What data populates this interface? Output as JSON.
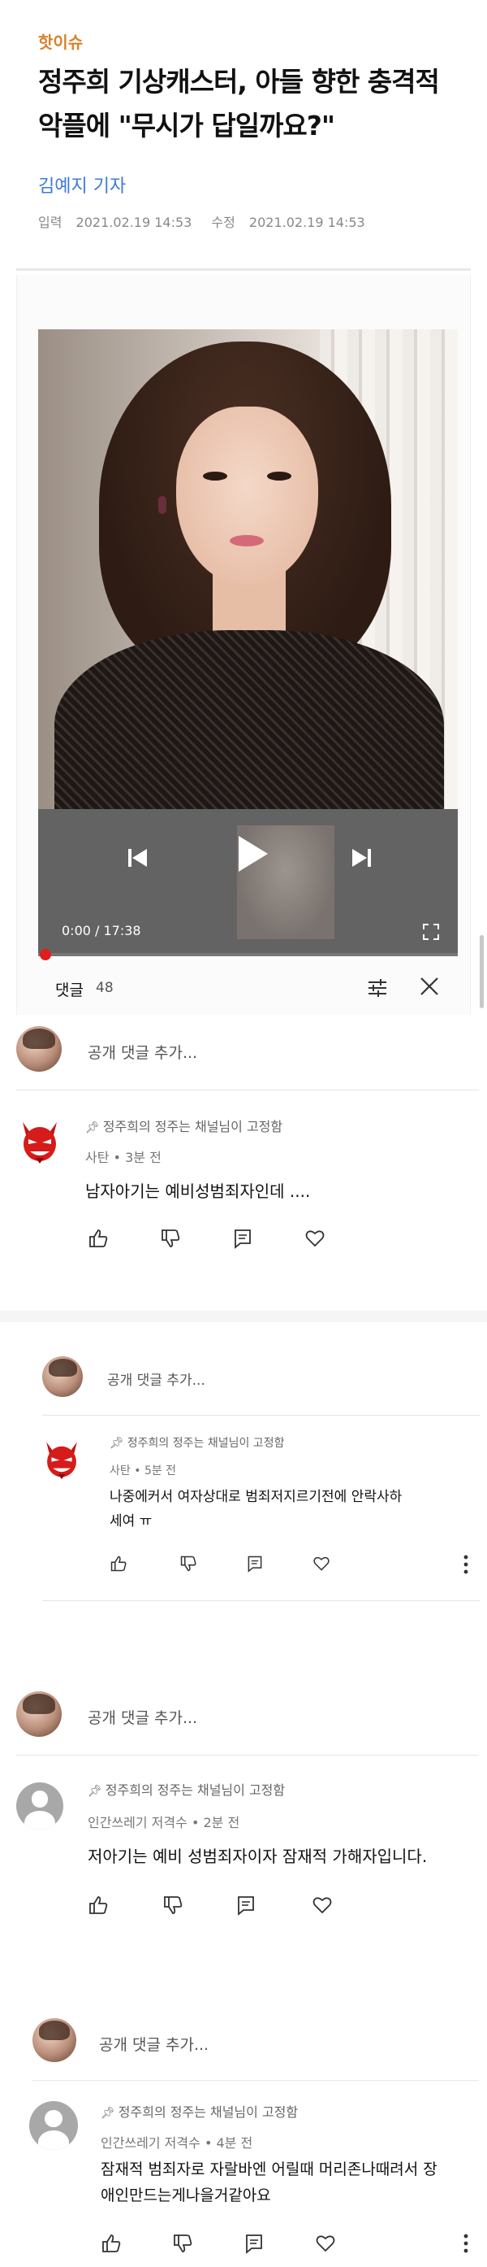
{
  "article": {
    "category": "핫이슈",
    "headline": "정주희 기상캐스터, 아들 향한 충격적 악플에 \"무시가 답일까요?\"",
    "reporter": "김예지 기자",
    "input_label": "입력",
    "input_date": "2021.02.19 14:53",
    "edit_label": "수정",
    "edit_date": "2021.02.19 14:53"
  },
  "video": {
    "time": "0:00 / 17:38",
    "progress": 0.0
  },
  "comments_panel": {
    "label": "댓글",
    "count": "48"
  },
  "threads": [
    {
      "add_placeholder": "공개 댓글 추가...",
      "pinned": "정주희의 정주는 채널님이 고정함",
      "author": "사탄",
      "time": "3분 전",
      "text": "남자아기는 예비성범죄자인데 ....",
      "avatar_icon": "devil-avatar-icon"
    },
    {
      "add_placeholder": "공개 댓글 추가...",
      "pinned": "정주희의 정주는 채널님이 고정함",
      "author": "사탄",
      "time": "5분 전",
      "text_line1": "나중에커서 여자상대로 범죄저지르기전에 안락사하",
      "text_line2": "세여 ㅠ",
      "avatar_icon": "devil-avatar-icon"
    },
    {
      "add_placeholder": "공개 댓글 추가...",
      "pinned": "정주희의 정주는 채널님이 고정함",
      "author": "인간쓰레기 저격수",
      "time": "2분 전",
      "text": "저아기는 예비 성범죄자이자 잠재적 가해자입니다.",
      "avatar_icon": "default-user-icon"
    },
    {
      "add_placeholder": "공개 댓글 추가...",
      "pinned": "정주희의 정주는 채널님이 고정함",
      "author": "인간쓰레기 저격수",
      "time": "4분 전",
      "text_line1": "잠재적 범죄자로 자랄바엔 어릴때 머리존나때려서 장",
      "text_line2": "애인만드는게나을거같아요",
      "avatar_icon": "default-user-icon"
    }
  ],
  "separator": "•",
  "colors": {
    "category": "#d9822b",
    "reporter": "#3b7bd8",
    "progress": "#e01e1e"
  }
}
